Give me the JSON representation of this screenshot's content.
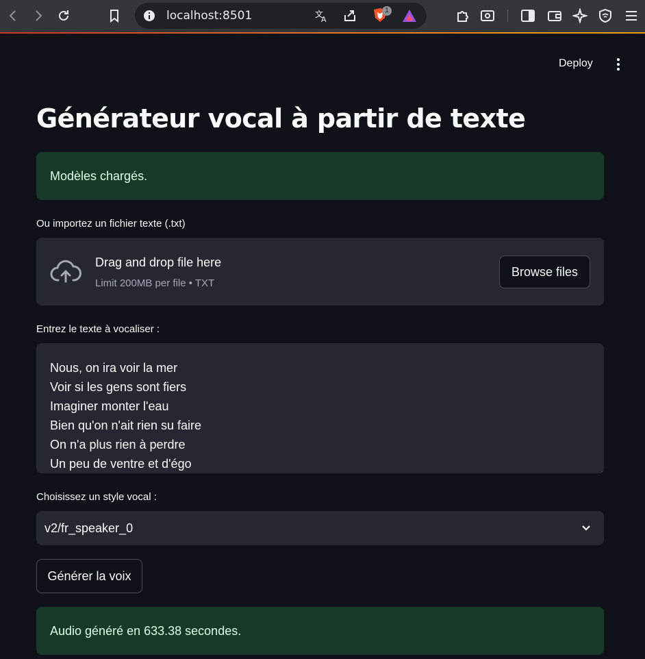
{
  "browser": {
    "url": "localhost:8501",
    "shields_badge": "1"
  },
  "header": {
    "deploy_label": "Deploy"
  },
  "page": {
    "title": "Générateur vocal à partir de texte",
    "status_loaded": "Modèles chargés.",
    "upload": {
      "label": "Ou importez un fichier texte (.txt)",
      "drop_title": "Drag and drop file here",
      "limit_text": "Limit 200MB per file • TXT",
      "browse_label": "Browse files"
    },
    "text_input": {
      "label": "Entrez le texte à vocaliser :",
      "lines": [
        "Nous, on ira voir la mer",
        "Voir si les gens sont fiers",
        "Imaginer monter l'eau",
        "Bien qu'on n'ait rien su faire",
        "On n'a plus rien à perdre",
        "Un peu de ventre et d'égo"
      ]
    },
    "voice": {
      "label": "Choisissez un style vocal :",
      "selected": "v2/fr_speaker_0"
    },
    "generate_label": "Générer la voix",
    "status_done": "Audio généré en 633.38 secondes."
  },
  "colors": {
    "background": "#0e1117",
    "success_bg": "#173928",
    "success_text": "#dffde9",
    "widget_bg": "#262730"
  }
}
